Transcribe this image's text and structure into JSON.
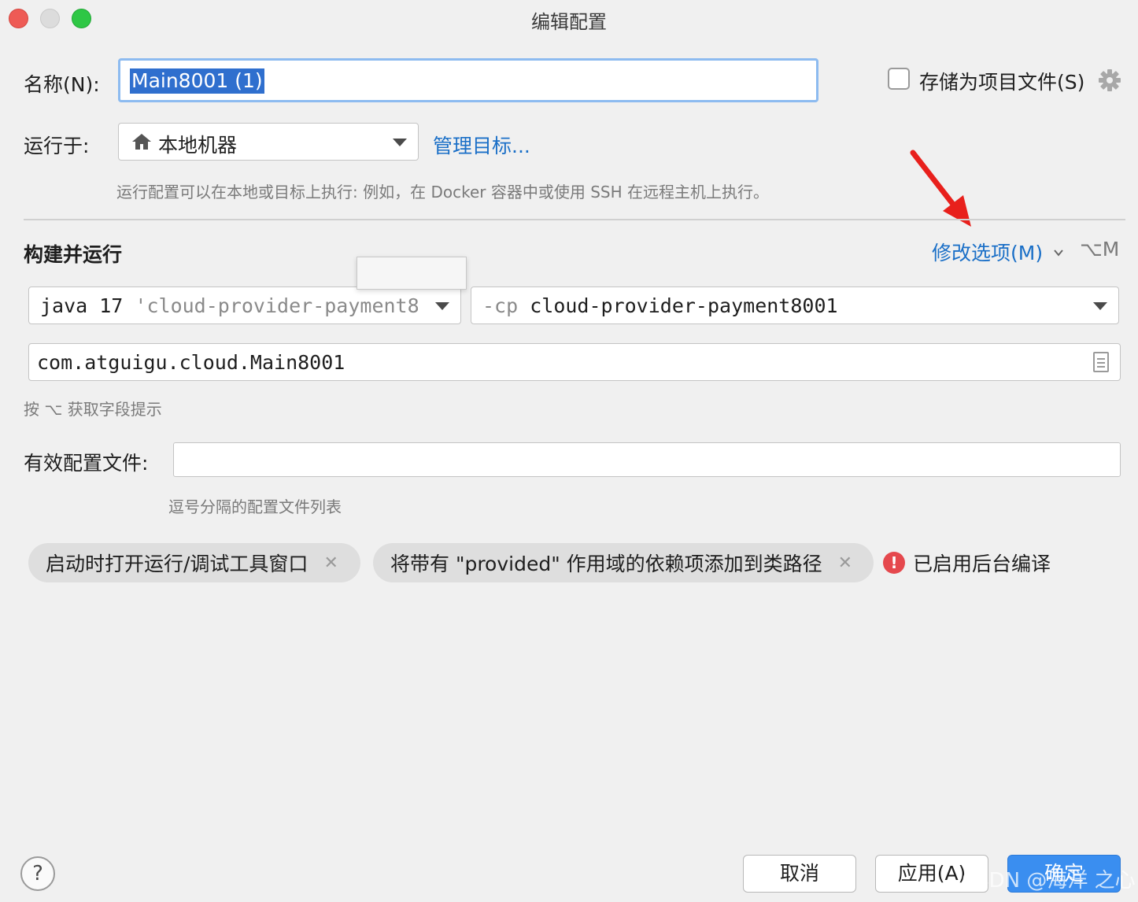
{
  "window": {
    "title": "编辑配置"
  },
  "name": {
    "label": "名称(N):",
    "value": "Main8001 (1)"
  },
  "store_as_file": {
    "label": "存储为项目文件(S)",
    "checked": false
  },
  "run_on": {
    "label": "运行于:",
    "target": "本地机器",
    "manage_link": "管理目标...",
    "hint": "运行配置可以在本地或目标上执行: 例如，在 Docker 容器中或使用 SSH 在远程主机上执行。"
  },
  "build_run": {
    "title": "构建并运行",
    "modify_options": "修改选项(M)",
    "shortcut": "⌥M",
    "jdk_prefix": "java 17",
    "jdk_module": "'cloud-provider-payment8",
    "cp_flag": "-cp",
    "cp_value": "cloud-provider-payment8001",
    "main_class": "com.atguigu.cloud.Main8001",
    "field_hint": "按 ⌥ 获取字段提示"
  },
  "profiles": {
    "label": "有效配置文件:",
    "value": "",
    "hint": "逗号分隔的配置文件列表"
  },
  "options": [
    {
      "label": "启动时打开运行/调试工具窗口",
      "removable": true
    },
    {
      "label": "将带有 \"provided\" 作用域的依赖项添加到类路径",
      "removable": true
    }
  ],
  "background_compile": {
    "label": "已启用后台编译",
    "icon": "error-icon"
  },
  "footer": {
    "help": "?",
    "cancel": "取消",
    "apply": "应用(A)",
    "ok": "确定"
  },
  "watermark": "CSDN @海洋 之心",
  "colors": {
    "accent": "#3a8ef0",
    "link": "#1a6fc7",
    "error": "#e5484d",
    "annotation_arrow": "#e8201c"
  }
}
